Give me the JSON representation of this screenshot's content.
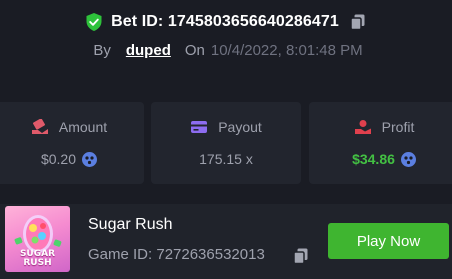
{
  "bet": {
    "id_label": "Bet ID: 1745803656640286471",
    "by_label": "By",
    "username": "duped",
    "on_label": "On",
    "date": "10/4/2022, 8:01:48 PM"
  },
  "stats": [
    {
      "label": "Amount",
      "value": "$0.20",
      "icon": "money-icon",
      "currency_icon": "crypto-coin-icon"
    },
    {
      "label": "Payout",
      "value": "175.15 x",
      "icon": "card-icon"
    },
    {
      "label": "Profit",
      "value": "$34.86",
      "icon": "profit-icon",
      "currency_icon": "crypto-coin-icon"
    }
  ],
  "game": {
    "thumbnail_text": "SUGAR RUSH",
    "name": "Sugar Rush",
    "id_label": "Game ID: 7272636532013",
    "play_label": "Play Now"
  },
  "colors": {
    "background": "#1a1c24",
    "card": "#22252e",
    "accent_green": "#3fb530",
    "profit_green": "#43c043",
    "shield_green": "#2ec23b",
    "amount_icon_red": "#e05a6a",
    "payout_icon_purple": "#8d6cf0",
    "profit_icon_red": "#e0404d",
    "coin_blue": "#5b7fe0"
  }
}
